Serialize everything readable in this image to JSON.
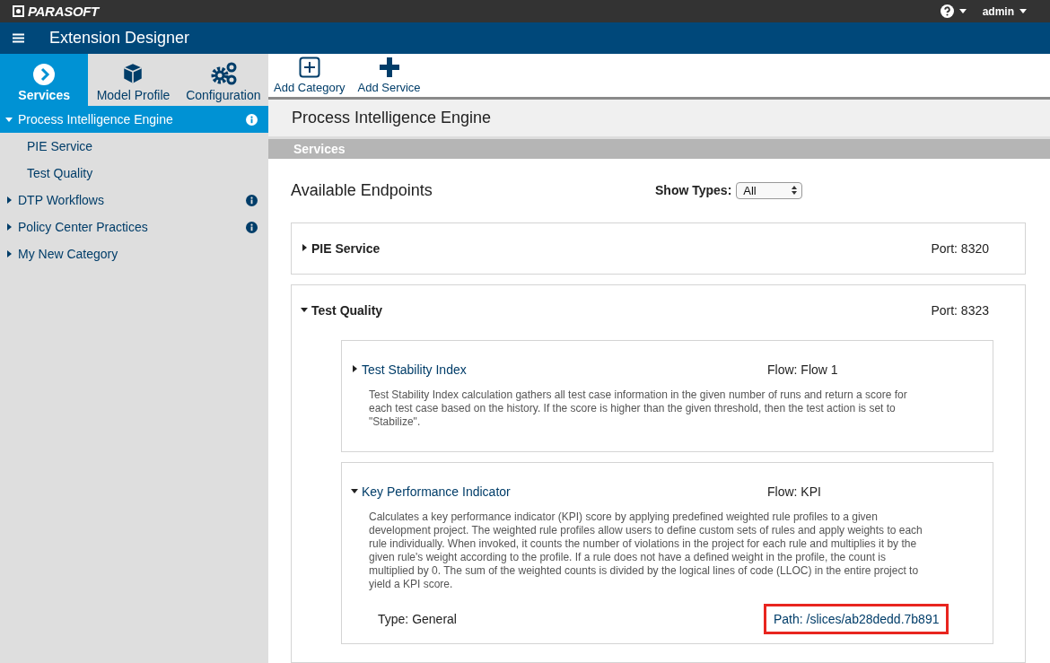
{
  "brand": {
    "logo": "PARASOFT"
  },
  "header": {
    "user": "admin"
  },
  "app_title": "Extension Designer",
  "nav_tabs": [
    {
      "label": "Services",
      "kind": "services",
      "selected": true
    },
    {
      "label": "Model Profile",
      "kind": "model",
      "selected": false
    },
    {
      "label": "Configuration",
      "kind": "config",
      "selected": false
    }
  ],
  "toolbar": [
    {
      "label": "Add Category",
      "kind": "category"
    },
    {
      "label": "Add Service",
      "kind": "service"
    }
  ],
  "sidebar": {
    "items": [
      {
        "label": "Process Intelligence Engine",
        "selected": true,
        "expanded": true,
        "info": true,
        "children": [
          {
            "label": "PIE Service"
          },
          {
            "label": "Test Quality"
          }
        ]
      },
      {
        "label": "DTP Workflows",
        "selected": false,
        "expanded": false,
        "info": true
      },
      {
        "label": "Policy Center Practices",
        "selected": false,
        "expanded": false,
        "info": true
      },
      {
        "label": "My New Category",
        "selected": false,
        "expanded": false,
        "info": false
      }
    ]
  },
  "main": {
    "title": "Process Intelligence Engine",
    "section": "Services",
    "heading": "Available Endpoints",
    "filter": {
      "label": "Show Types:",
      "value": "All"
    },
    "endpoints": [
      {
        "name": "PIE Service",
        "port": "Port: 8320",
        "expanded": false
      },
      {
        "name": "Test Quality",
        "port": "Port: 8323",
        "expanded": true,
        "flows": [
          {
            "name": "Test Stability Index",
            "flow": "Flow: Flow 1",
            "expanded": false,
            "description": "Test Stability Index calculation gathers all test case information in the given number of runs and return a score for each test case based on the history. If the score is higher than the given threshold, then the test action is set to \"Stabilize\"."
          },
          {
            "name": "Key Performance Indicator",
            "flow": "Flow: KPI",
            "expanded": true,
            "description": "Calculates a key performance indicator (KPI) score by applying predefined weighted rule profiles to a given development project. The weighted rule profiles allow users to define custom sets of rules and apply weights to each rule individually. When invoked, it counts the number of violations in the project for each rule and multiplies it by the given rule's weight according to the profile. If a rule does not have a defined weight in the profile, the count is multiplied by 0. The sum of the weighted counts is divided by the logical lines of code (LLOC) in the entire project to yield a KPI score.",
            "type": "Type: General",
            "path": "Path: /slices/ab28dedd.7b891",
            "highlighted": true
          }
        ]
      }
    ]
  }
}
